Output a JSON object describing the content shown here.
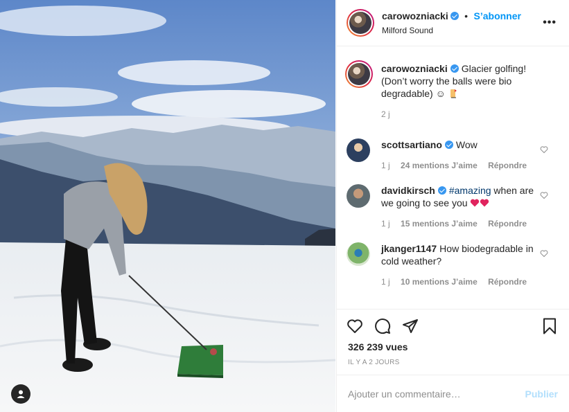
{
  "post": {
    "username": "carowozniacki",
    "follow_label": "S’abonner",
    "separator": "•",
    "location": "Milford Sound",
    "more_label": "•••",
    "caption": {
      "username": "carowozniacki",
      "text": "Glacier golfing! (Don’t worry the balls were bio degradable) ☺",
      "time": "2 j"
    }
  },
  "comments": [
    {
      "username": "scottsartiano",
      "verified": true,
      "text": "Wow",
      "time": "1 j",
      "likes": "24 mentions J’aime",
      "reply": "Répondre"
    },
    {
      "username": "davidkirsch",
      "verified": true,
      "hashtag": "#amazing",
      "text": " when are we going to see you",
      "time": "1 j",
      "likes": "15 mentions J’aime",
      "reply": "Répondre"
    },
    {
      "username": "jkanger1147",
      "verified": false,
      "text": "How biodegradable in cold weather?",
      "time": "1 j",
      "likes": "10 mentions J’aime",
      "reply": "Répondre"
    }
  ],
  "actions": {
    "views": "326 239 vues",
    "timestamp": "IL Y A 2 JOURS"
  },
  "add_comment": {
    "placeholder": "Ajouter un commentaire…",
    "publish_label": "Publier"
  },
  "icons": {
    "like": "heart-icon",
    "comment": "comment-icon",
    "share": "share-icon",
    "save": "bookmark-icon",
    "user": "user-icon"
  },
  "colors": {
    "accent": "#0095f6",
    "verified": "#3897f0",
    "publish_disabled": "#b2dffc",
    "heart_emoji": "#e0245e"
  }
}
